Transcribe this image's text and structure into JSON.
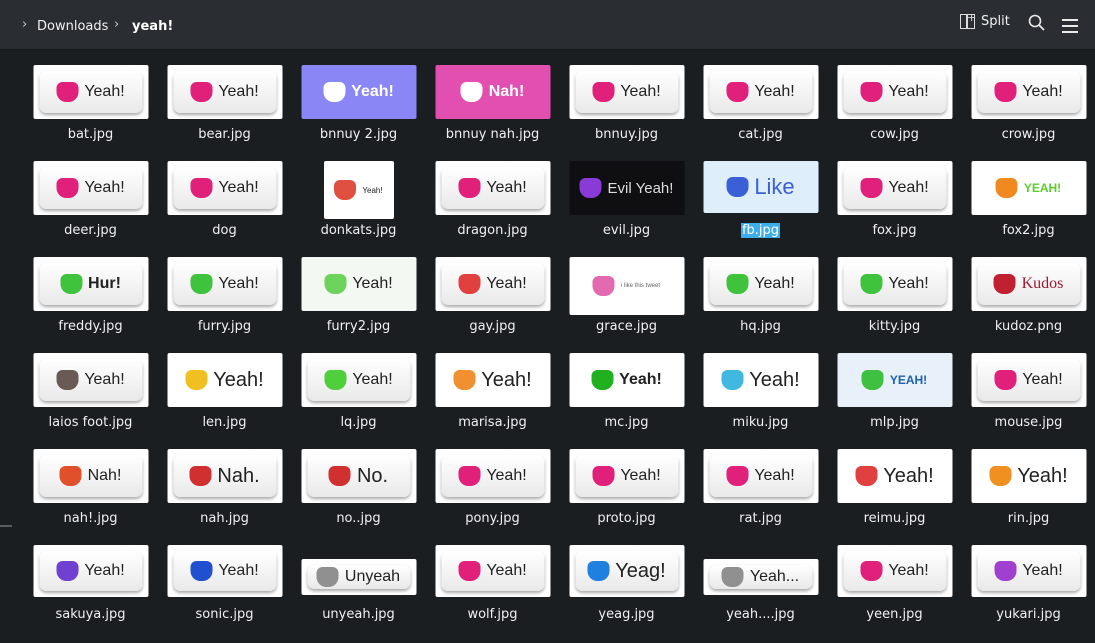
{
  "breadcrumb": {
    "items": [
      "Downloads",
      "yeah!"
    ]
  },
  "toolbar": {
    "split_label": "Split",
    "icons": [
      "split-view-icon",
      "search-icon",
      "hamburger-menu-icon"
    ]
  },
  "colors": {
    "background": "#1b1e20",
    "toolbar": "#2a2e32",
    "selection": "#3daee9"
  },
  "files": [
    {
      "name": "bat.jpg",
      "text": "Yeah!",
      "icon": "#e0207a",
      "bg": "#ffffff"
    },
    {
      "name": "bear.jpg",
      "text": "Yeah!",
      "icon": "#e0207a",
      "bg": "#ffffff"
    },
    {
      "name": "bnnuy 2.jpg",
      "text": "Yeah!",
      "icon": "#ffffff",
      "bg": "#8a86f5"
    },
    {
      "name": "bnnuy nah.jpg",
      "text": "Nah!",
      "icon": "#ffffff",
      "bg": "#e24fb0"
    },
    {
      "name": "bnnuy.jpg",
      "text": "Yeah!",
      "icon": "#e0207a",
      "bg": "#ffffff"
    },
    {
      "name": "cat.jpg",
      "text": "Yeah!",
      "icon": "#e0207a",
      "bg": "#ffffff"
    },
    {
      "name": "cow.jpg",
      "text": "Yeah!",
      "icon": "#e0207a",
      "bg": "#ffffff"
    },
    {
      "name": "crow.jpg",
      "text": "Yeah!",
      "icon": "#e0207a",
      "bg": "#ffffff"
    },
    {
      "name": "deer.jpg",
      "text": "Yeah!",
      "icon": "#e0207a",
      "bg": "#ffffff"
    },
    {
      "name": "dog",
      "text": "Yeah!",
      "icon": "#e0207a",
      "bg": "#ffffff"
    },
    {
      "name": "donkats.jpg",
      "text": "Yeah!",
      "icon": "#e05040",
      "bg": "#ffffff"
    },
    {
      "name": "dragon.jpg",
      "text": "Yeah!",
      "icon": "#e0207a",
      "bg": "#ffffff"
    },
    {
      "name": "evil.jpg",
      "text": "Evil Yeah!",
      "icon": "#8a3ad6",
      "bg": "#0f0f12"
    },
    {
      "name": "fb.jpg",
      "text": "Like",
      "icon": "#3b5fd6",
      "bg": "#dfeefb"
    },
    {
      "name": "fox.jpg",
      "text": "Yeah!",
      "icon": "#e0207a",
      "bg": "#ffffff"
    },
    {
      "name": "fox2.jpg",
      "text": "YEAH!",
      "icon": "#f08a20",
      "bg": "#ffffff"
    },
    {
      "name": "freddy.jpg",
      "text": "Hur!",
      "icon": "#3fc23c",
      "bg": "#ffffff"
    },
    {
      "name": "furry.jpg",
      "text": "Yeah!",
      "icon": "#3fc23c",
      "bg": "#ffffff"
    },
    {
      "name": "furry2.jpg",
      "text": "Yeah!",
      "icon": "#6ed35c",
      "bg": "#f4f8f2"
    },
    {
      "name": "gay.jpg",
      "text": "Yeah!",
      "icon": "#e04040",
      "bg": "#ffffff"
    },
    {
      "name": "grace.jpg",
      "text": "i like this tweet",
      "icon": "#e36ab0",
      "bg": "#ffffff"
    },
    {
      "name": "hq.jpg",
      "text": "Yeah!",
      "icon": "#3fc23c",
      "bg": "#ffffff"
    },
    {
      "name": "kitty.jpg",
      "text": "Yeah!",
      "icon": "#3fc23c",
      "bg": "#ffffff"
    },
    {
      "name": "kudoz.png",
      "text": "Kudos",
      "icon": "#c02030",
      "bg": "#ffffff"
    },
    {
      "name": "laios foot.jpg",
      "text": "Yeah!",
      "icon": "#6a5a55",
      "bg": "#ffffff"
    },
    {
      "name": "len.jpg",
      "text": "Yeah!",
      "icon": "#f0c020",
      "bg": "#ffffff"
    },
    {
      "name": "lq.jpg",
      "text": "Yeah!",
      "icon": "#4fcf3c",
      "bg": "#ffffff"
    },
    {
      "name": "marisa.jpg",
      "text": "Yeah!",
      "icon": "#f09030",
      "bg": "#ffffff"
    },
    {
      "name": "mc.jpg",
      "text": "Yeah!",
      "icon": "#20b020",
      "bg": "#ffffff"
    },
    {
      "name": "miku.jpg",
      "text": "Yeah!",
      "icon": "#40b8e0",
      "bg": "#ffffff"
    },
    {
      "name": "mlp.jpg",
      "text": "YEAH!",
      "icon": "#40c040",
      "bg": "#e8f0fa"
    },
    {
      "name": "mouse.jpg",
      "text": "Yeah!",
      "icon": "#e0207a",
      "bg": "#ffffff"
    },
    {
      "name": "nah!.jpg",
      "text": "Nah!",
      "icon": "#e0502a",
      "bg": "#ffffff"
    },
    {
      "name": "nah.jpg",
      "text": "Nah.",
      "icon": "#d03030",
      "bg": "#ffffff"
    },
    {
      "name": "no..jpg",
      "text": "No.",
      "icon": "#d03030",
      "bg": "#ffffff"
    },
    {
      "name": "pony.jpg",
      "text": "Yeah!",
      "icon": "#e0207a",
      "bg": "#ffffff"
    },
    {
      "name": "proto.jpg",
      "text": "Yeah!",
      "icon": "#e0207a",
      "bg": "#ffffff"
    },
    {
      "name": "rat.jpg",
      "text": "Yeah!",
      "icon": "#e0207a",
      "bg": "#ffffff"
    },
    {
      "name": "reimu.jpg",
      "text": "Yeah!",
      "icon": "#e04040",
      "bg": "#ffffff"
    },
    {
      "name": "rin.jpg",
      "text": "Yeah!",
      "icon": "#f09020",
      "bg": "#ffffff"
    },
    {
      "name": "sakuya.jpg",
      "text": "Yeah!",
      "icon": "#7040d0",
      "bg": "#ffffff"
    },
    {
      "name": "sonic.jpg",
      "text": "Yeah!",
      "icon": "#2050d0",
      "bg": "#ffffff"
    },
    {
      "name": "unyeah.jpg",
      "text": "Unyeah",
      "icon": "#909090",
      "bg": "#ffffff"
    },
    {
      "name": "wolf.jpg",
      "text": "Yeah!",
      "icon": "#e0207a",
      "bg": "#ffffff"
    },
    {
      "name": "yeag.jpg",
      "text": "Yeag!",
      "icon": "#2080e0",
      "bg": "#ffffff"
    },
    {
      "name": "yeah....jpg",
      "text": "Yeah...",
      "icon": "#909090",
      "bg": "#ffffff"
    },
    {
      "name": "yeen.jpg",
      "text": "Yeah!",
      "icon": "#e0207a",
      "bg": "#ffffff"
    },
    {
      "name": "yukari.jpg",
      "text": "Yeah!",
      "icon": "#a040d0",
      "bg": "#ffffff"
    }
  ],
  "selected_file": "fb.jpg"
}
